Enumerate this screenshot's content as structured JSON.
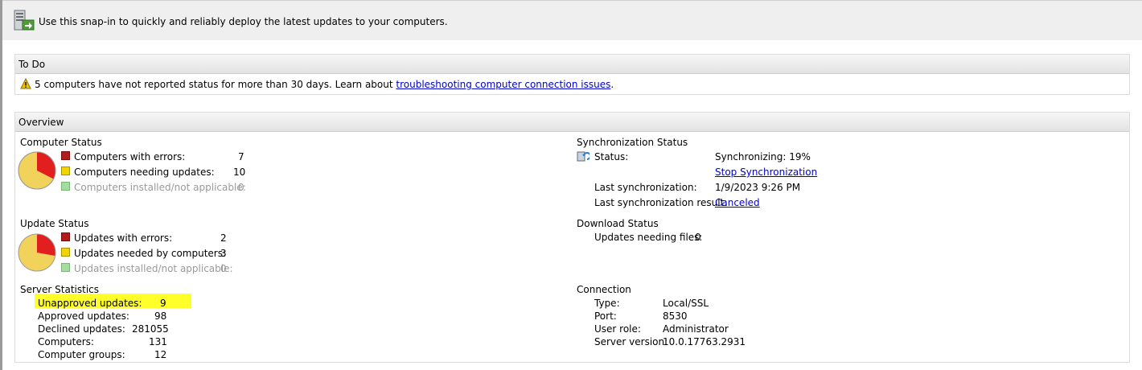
{
  "header": {
    "description": "Use this snap-in to quickly and reliably deploy the latest updates to your computers."
  },
  "todo": {
    "title": "To Do",
    "message": "5 computers have not reported status for more than 30 days. Learn about ",
    "link": "troubleshooting computer connection issues",
    "suffix": "."
  },
  "overview": {
    "title": "Overview",
    "computer_status": {
      "title": "Computer Status",
      "rows": [
        {
          "label": "Computers with errors:",
          "value": "7"
        },
        {
          "label": "Computers needing updates:",
          "value": "10"
        },
        {
          "label": "Computers installed/not applicable:",
          "value": "0"
        }
      ]
    },
    "update_status": {
      "title": "Update Status",
      "rows": [
        {
          "label": "Updates with errors:",
          "value": "2"
        },
        {
          "label": "Updates needed by computers:",
          "value": "3"
        },
        {
          "label": "Updates installed/not applicable:",
          "value": "0"
        }
      ]
    },
    "server_statistics": {
      "title": "Server Statistics",
      "rows": [
        {
          "label": "Unapproved updates:",
          "value": "9"
        },
        {
          "label": "Approved updates:",
          "value": "98"
        },
        {
          "label": "Declined updates:",
          "value": "281055"
        },
        {
          "label": "Computers:",
          "value": "131"
        },
        {
          "label": "Computer groups:",
          "value": "12"
        }
      ]
    },
    "sync_status": {
      "title": "Synchronization Status",
      "status_label": "Status:",
      "status_value": "Synchronizing: 19%",
      "stop_link": "Stop Synchronization",
      "last_sync_label": "Last synchronization:",
      "last_sync_value": "1/9/2023 9:26 PM",
      "last_result_label": "Last synchronization result:",
      "last_result_link": "Canceled"
    },
    "download_status": {
      "title": "Download Status",
      "label": "Updates needing files:",
      "value": "0"
    },
    "connection": {
      "title": "Connection",
      "rows": [
        {
          "label": "Type:",
          "value": "Local/SSL"
        },
        {
          "label": "Port:",
          "value": "8530"
        },
        {
          "label": "User role:",
          "value": "Administrator"
        },
        {
          "label": "Server version:",
          "value": "10.0.17763.2931"
        }
      ]
    }
  },
  "colors": {
    "error": "#b31b1b",
    "needed": "#f2d400",
    "installed": "#a5dca1",
    "highlight": "#ffff2a",
    "link": "#0000cc"
  },
  "icons": [
    "server-update-icon",
    "warning-icon",
    "sync-icon"
  ]
}
